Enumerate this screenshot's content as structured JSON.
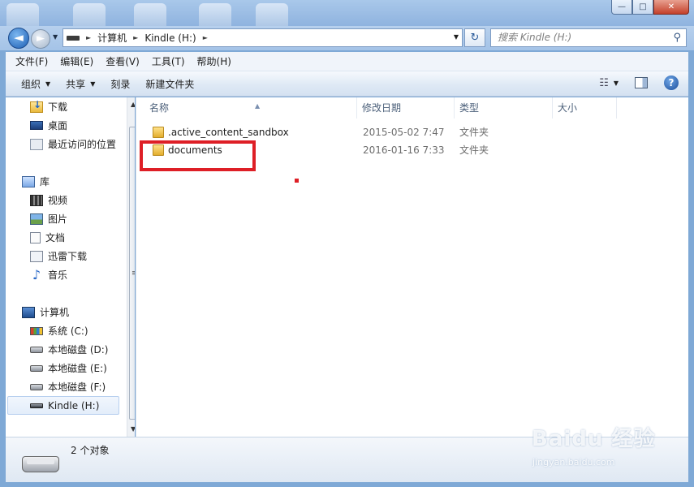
{
  "window": {
    "caption_buttons": {
      "minimize": "—",
      "maximize": "□",
      "close": "✕"
    }
  },
  "address": {
    "back_glyph": "◄",
    "forward_glyph": "►",
    "history_glyph": "▼",
    "breadcrumb": [
      "计算机",
      "Kindle (H:)"
    ],
    "breadcrumb_sep": "►",
    "dropdown_glyph": "▼",
    "refresh_glyph": "↻",
    "search_placeholder": "搜索 Kindle (H:)",
    "search_glyph": "⚲"
  },
  "menubar": {
    "items": [
      "文件(F)",
      "编辑(E)",
      "查看(V)",
      "工具(T)",
      "帮助(H)"
    ]
  },
  "toolbar": {
    "organize": "组织",
    "share": "共享",
    "burn": "刻录",
    "new_folder": "新建文件夹",
    "caret": "▼",
    "view_glyph": "☷",
    "help_glyph": "?"
  },
  "navpane": {
    "favorites": [
      "下载",
      "桌面",
      "最近访问的位置"
    ],
    "libraries_title": "库",
    "libraries": [
      "视频",
      "图片",
      "文档",
      "迅雷下载",
      "音乐"
    ],
    "computer_title": "计算机",
    "drives": [
      "系统 (C:)",
      "本地磁盘 (D:)",
      "本地磁盘 (E:)",
      "本地磁盘 (F:)",
      "Kindle (H:)"
    ],
    "scroll_up": "▲",
    "scroll_down": "▼",
    "grip": "≡",
    "music_glyph": "♪"
  },
  "filelist": {
    "columns": [
      "名称",
      "修改日期",
      "类型",
      "大小"
    ],
    "sort_caret": "▲",
    "rows": [
      {
        "name": ".active_content_sandbox",
        "date": "2015-05-02 7:47",
        "type": "文件夹"
      },
      {
        "name": "documents",
        "date": "2016-01-16 7:33",
        "type": "文件夹"
      }
    ]
  },
  "status": {
    "count_text": "2 个对象"
  },
  "watermark": {
    "brand": "Baidu 经验",
    "url": "jingyan.baidu.com"
  },
  "colors": {
    "highlight": "#de1f26",
    "accent": "#1d5fb4"
  }
}
